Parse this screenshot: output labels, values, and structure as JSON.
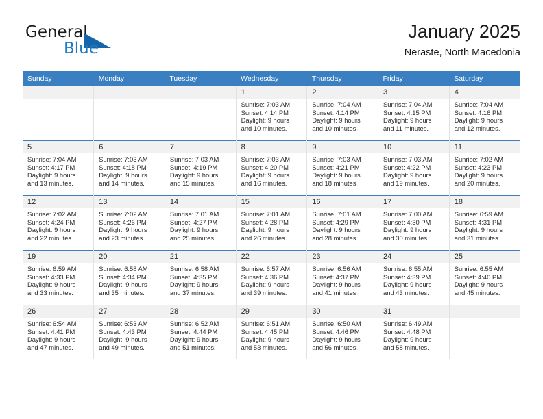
{
  "brand": {
    "name_top": "General",
    "name_bottom": "Blue",
    "accent_color": "#1f7ac0",
    "triangle_color": "#1565a8",
    "triangle_icon": "brand-triangle-icon"
  },
  "header": {
    "title": "January 2025",
    "subtitle": "Neraste, North Macedonia"
  },
  "calendar": {
    "header_bg": "#3a7fc1",
    "header_text_color": "#ffffff",
    "date_band_bg": "#f1f1f1",
    "row_divider_color": "#3a7fc1",
    "weekdays": [
      "Sunday",
      "Monday",
      "Tuesday",
      "Wednesday",
      "Thursday",
      "Friday",
      "Saturday"
    ],
    "weeks": [
      [
        {
          "date": "",
          "lines": []
        },
        {
          "date": "",
          "lines": []
        },
        {
          "date": "",
          "lines": []
        },
        {
          "date": "1",
          "lines": [
            "Sunrise: 7:03 AM",
            "Sunset: 4:14 PM",
            "Daylight: 9 hours",
            "and 10 minutes."
          ]
        },
        {
          "date": "2",
          "lines": [
            "Sunrise: 7:04 AM",
            "Sunset: 4:14 PM",
            "Daylight: 9 hours",
            "and 10 minutes."
          ]
        },
        {
          "date": "3",
          "lines": [
            "Sunrise: 7:04 AM",
            "Sunset: 4:15 PM",
            "Daylight: 9 hours",
            "and 11 minutes."
          ]
        },
        {
          "date": "4",
          "lines": [
            "Sunrise: 7:04 AM",
            "Sunset: 4:16 PM",
            "Daylight: 9 hours",
            "and 12 minutes."
          ]
        }
      ],
      [
        {
          "date": "5",
          "lines": [
            "Sunrise: 7:04 AM",
            "Sunset: 4:17 PM",
            "Daylight: 9 hours",
            "and 13 minutes."
          ]
        },
        {
          "date": "6",
          "lines": [
            "Sunrise: 7:03 AM",
            "Sunset: 4:18 PM",
            "Daylight: 9 hours",
            "and 14 minutes."
          ]
        },
        {
          "date": "7",
          "lines": [
            "Sunrise: 7:03 AM",
            "Sunset: 4:19 PM",
            "Daylight: 9 hours",
            "and 15 minutes."
          ]
        },
        {
          "date": "8",
          "lines": [
            "Sunrise: 7:03 AM",
            "Sunset: 4:20 PM",
            "Daylight: 9 hours",
            "and 16 minutes."
          ]
        },
        {
          "date": "9",
          "lines": [
            "Sunrise: 7:03 AM",
            "Sunset: 4:21 PM",
            "Daylight: 9 hours",
            "and 18 minutes."
          ]
        },
        {
          "date": "10",
          "lines": [
            "Sunrise: 7:03 AM",
            "Sunset: 4:22 PM",
            "Daylight: 9 hours",
            "and 19 minutes."
          ]
        },
        {
          "date": "11",
          "lines": [
            "Sunrise: 7:02 AM",
            "Sunset: 4:23 PM",
            "Daylight: 9 hours",
            "and 20 minutes."
          ]
        }
      ],
      [
        {
          "date": "12",
          "lines": [
            "Sunrise: 7:02 AM",
            "Sunset: 4:24 PM",
            "Daylight: 9 hours",
            "and 22 minutes."
          ]
        },
        {
          "date": "13",
          "lines": [
            "Sunrise: 7:02 AM",
            "Sunset: 4:26 PM",
            "Daylight: 9 hours",
            "and 23 minutes."
          ]
        },
        {
          "date": "14",
          "lines": [
            "Sunrise: 7:01 AM",
            "Sunset: 4:27 PM",
            "Daylight: 9 hours",
            "and 25 minutes."
          ]
        },
        {
          "date": "15",
          "lines": [
            "Sunrise: 7:01 AM",
            "Sunset: 4:28 PM",
            "Daylight: 9 hours",
            "and 26 minutes."
          ]
        },
        {
          "date": "16",
          "lines": [
            "Sunrise: 7:01 AM",
            "Sunset: 4:29 PM",
            "Daylight: 9 hours",
            "and 28 minutes."
          ]
        },
        {
          "date": "17",
          "lines": [
            "Sunrise: 7:00 AM",
            "Sunset: 4:30 PM",
            "Daylight: 9 hours",
            "and 30 minutes."
          ]
        },
        {
          "date": "18",
          "lines": [
            "Sunrise: 6:59 AM",
            "Sunset: 4:31 PM",
            "Daylight: 9 hours",
            "and 31 minutes."
          ]
        }
      ],
      [
        {
          "date": "19",
          "lines": [
            "Sunrise: 6:59 AM",
            "Sunset: 4:33 PM",
            "Daylight: 9 hours",
            "and 33 minutes."
          ]
        },
        {
          "date": "20",
          "lines": [
            "Sunrise: 6:58 AM",
            "Sunset: 4:34 PM",
            "Daylight: 9 hours",
            "and 35 minutes."
          ]
        },
        {
          "date": "21",
          "lines": [
            "Sunrise: 6:58 AM",
            "Sunset: 4:35 PM",
            "Daylight: 9 hours",
            "and 37 minutes."
          ]
        },
        {
          "date": "22",
          "lines": [
            "Sunrise: 6:57 AM",
            "Sunset: 4:36 PM",
            "Daylight: 9 hours",
            "and 39 minutes."
          ]
        },
        {
          "date": "23",
          "lines": [
            "Sunrise: 6:56 AM",
            "Sunset: 4:37 PM",
            "Daylight: 9 hours",
            "and 41 minutes."
          ]
        },
        {
          "date": "24",
          "lines": [
            "Sunrise: 6:55 AM",
            "Sunset: 4:39 PM",
            "Daylight: 9 hours",
            "and 43 minutes."
          ]
        },
        {
          "date": "25",
          "lines": [
            "Sunrise: 6:55 AM",
            "Sunset: 4:40 PM",
            "Daylight: 9 hours",
            "and 45 minutes."
          ]
        }
      ],
      [
        {
          "date": "26",
          "lines": [
            "Sunrise: 6:54 AM",
            "Sunset: 4:41 PM",
            "Daylight: 9 hours",
            "and 47 minutes."
          ]
        },
        {
          "date": "27",
          "lines": [
            "Sunrise: 6:53 AM",
            "Sunset: 4:43 PM",
            "Daylight: 9 hours",
            "and 49 minutes."
          ]
        },
        {
          "date": "28",
          "lines": [
            "Sunrise: 6:52 AM",
            "Sunset: 4:44 PM",
            "Daylight: 9 hours",
            "and 51 minutes."
          ]
        },
        {
          "date": "29",
          "lines": [
            "Sunrise: 6:51 AM",
            "Sunset: 4:45 PM",
            "Daylight: 9 hours",
            "and 53 minutes."
          ]
        },
        {
          "date": "30",
          "lines": [
            "Sunrise: 6:50 AM",
            "Sunset: 4:46 PM",
            "Daylight: 9 hours",
            "and 56 minutes."
          ]
        },
        {
          "date": "31",
          "lines": [
            "Sunrise: 6:49 AM",
            "Sunset: 4:48 PM",
            "Daylight: 9 hours",
            "and 58 minutes."
          ]
        },
        {
          "date": "",
          "lines": []
        }
      ]
    ]
  }
}
